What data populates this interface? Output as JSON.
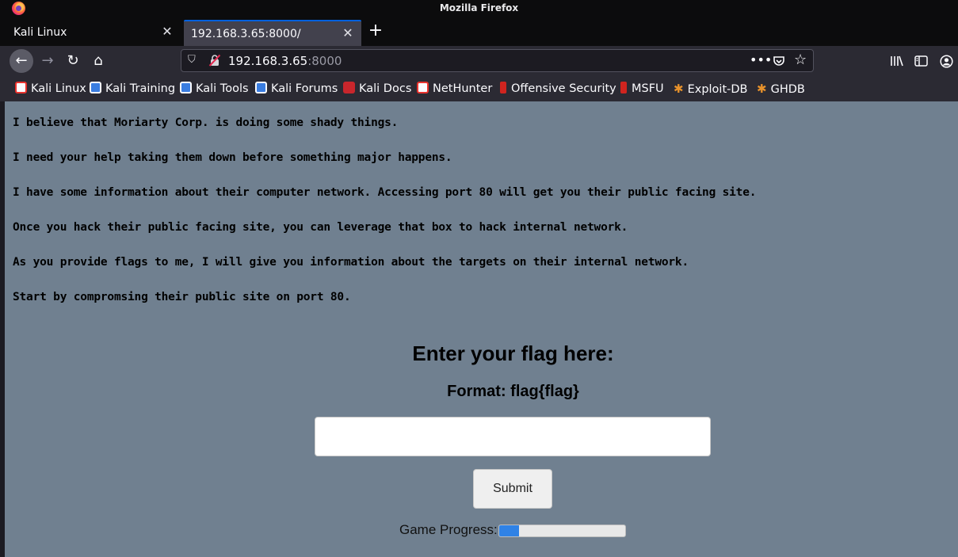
{
  "window": {
    "title": "Mozilla Firefox"
  },
  "tabs": [
    {
      "label": "Kali Linux",
      "active": false
    },
    {
      "label": "192.168.3.65:8000/",
      "active": true
    }
  ],
  "urlbar": {
    "host": "192.168.3.65",
    "port": ":8000"
  },
  "bookmarks": [
    {
      "label": "Kali Linux",
      "icon": "kali-icon"
    },
    {
      "label": "Kali Training",
      "icon": "kali-training-icon"
    },
    {
      "label": "Kali Tools",
      "icon": "kali-tools-icon"
    },
    {
      "label": "Kali Forums",
      "icon": "kali-forums-icon"
    },
    {
      "label": "Kali Docs",
      "icon": "kali-docs-icon"
    },
    {
      "label": "NetHunter",
      "icon": "nethunter-icon"
    },
    {
      "label": "Offensive Security",
      "icon": "offsec-icon"
    },
    {
      "label": "MSFU",
      "icon": "msfu-icon"
    },
    {
      "label": "Exploit-DB",
      "icon": "exploitdb-spider-icon"
    },
    {
      "label": "GHDB",
      "icon": "ghdb-spider-icon"
    }
  ],
  "page": {
    "paragraphs": [
      "I believe that Moriarty Corp. is doing some shady things.",
      "I need your help taking them down before something major happens.",
      "I have some information about their computer network. Accessing port 80 will get you their public facing site.",
      "Once you hack their public facing site, you can leverage that box to hack internal network.",
      "As you provide flags to me, I will give you information about the targets on their internal network.",
      "Start by compromsing their public site on port 80."
    ],
    "heading": "Enter your flag here:",
    "format": "Format: flag{flag}",
    "flag_value": "",
    "submit_label": "Submit",
    "progress_label": "Game Progress:",
    "progress_fraction": 0.16
  },
  "colors": {
    "page_background": "#708090",
    "progress_fill": "#2f82e6",
    "active_tab_accent": "#0060df"
  }
}
